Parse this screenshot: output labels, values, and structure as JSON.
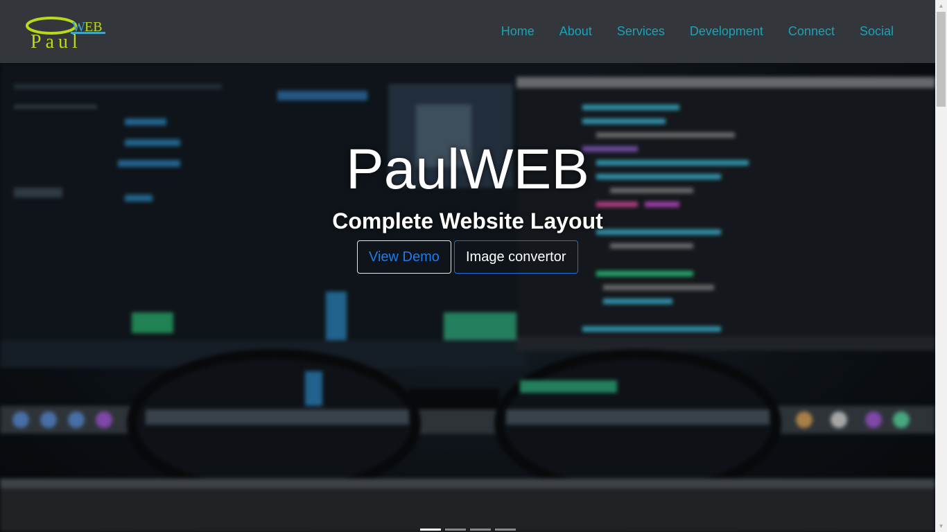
{
  "logo": {
    "text_top": "WEB",
    "text_main": "Paul"
  },
  "nav": {
    "items": [
      {
        "label": "Home"
      },
      {
        "label": "About"
      },
      {
        "label": "Services"
      },
      {
        "label": "Development"
      },
      {
        "label": "Connect"
      },
      {
        "label": "Social"
      }
    ]
  },
  "hero": {
    "title": "PaulWEB",
    "subtitle": "Complete Website Layout",
    "buttons": {
      "demo_label": "View Demo",
      "converter_label": "Image convertor"
    },
    "carousel": {
      "slide_count": 4,
      "active_index": 0
    }
  },
  "colors": {
    "navbar_bg": "#33363b",
    "nav_link": "#1aa3b8",
    "demo_text": "#1f7cf0",
    "converter_border": "#1f6fe0"
  }
}
